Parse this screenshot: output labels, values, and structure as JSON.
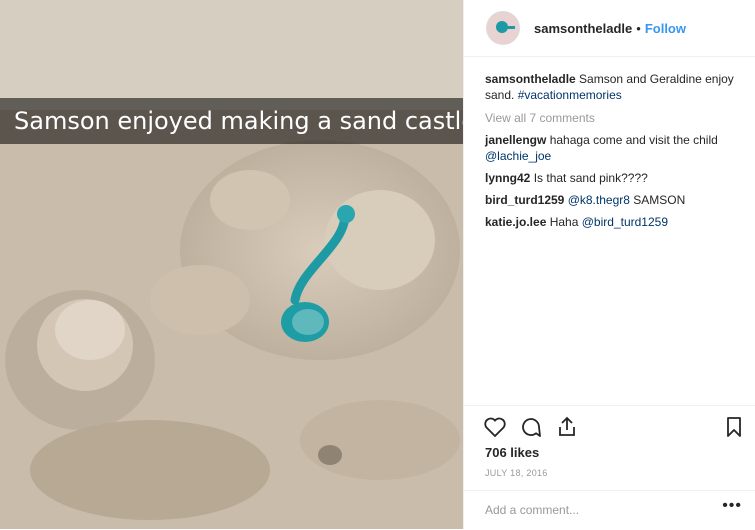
{
  "post": {
    "overlay_caption": "Samson enjoyed making a sand castle.",
    "username": "samsontheladle",
    "separator": "•",
    "follow_label": "Follow",
    "caption_text": "Samson and Geraldine enjoy sand.",
    "caption_hashtag": "#vacationmemories",
    "view_all_comments": "View all 7 comments",
    "comments": [
      {
        "user": "janellengw",
        "text": "hahaga come and visit the child",
        "mention": "@lachie_joe"
      },
      {
        "user": "lynng42",
        "text": "Is that sand pink????",
        "mention": ""
      },
      {
        "user": "bird_turd1259",
        "text": "",
        "mention": "@k8.thegr8",
        "text_after": "SAMSON"
      },
      {
        "user": "katie.jo.lee",
        "text": "Haha",
        "mention": "@bird_turd1259"
      }
    ],
    "likes": "706 likes",
    "date": "JULY 18, 2016",
    "add_comment_placeholder": "Add a comment...",
    "more_options": "•••"
  },
  "icons": [
    "heart-icon",
    "comment-icon",
    "share-icon",
    "bookmark-icon",
    "small-heart-icon"
  ],
  "colors": {
    "link": "#003569",
    "follow": "#3897f0",
    "muted": "#999999",
    "ladle": "#1d9aa3"
  }
}
